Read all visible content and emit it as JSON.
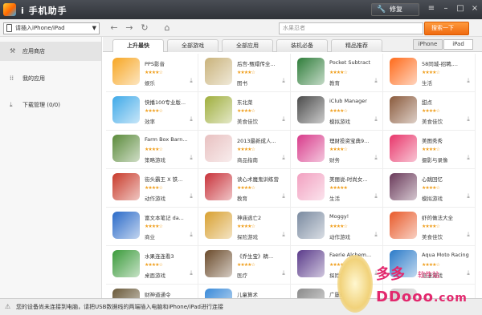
{
  "window": {
    "title": "i 手机助手",
    "repair_label": "修复",
    "repair_icon": "wrench-icon"
  },
  "toolbar": {
    "device_label": "请插入iPhone/iPad",
    "search_placeholder": "水果忍者",
    "search_button": "搜索一下"
  },
  "sidebar": {
    "items": [
      {
        "label": "应用商店",
        "icon": "store-icon"
      },
      {
        "label": "我的应用",
        "icon": "apps-grid-icon"
      },
      {
        "label": "下载管理 (0/0)",
        "icon": "download-icon"
      }
    ]
  },
  "tabs": [
    "上升最快",
    "全部游戏",
    "全部应用",
    "装机必备",
    "精品推荐"
  ],
  "device_toggle": [
    "iPhone",
    "iPad"
  ],
  "apps": [
    {
      "name": "PPS影音",
      "cat": "娱乐",
      "stars": 4,
      "color": "#f7a623"
    },
    {
      "name": "后宫-甄嬛传全...",
      "cat": "图书",
      "stars": 4,
      "color": "#c9b27a"
    },
    {
      "name": "Pocket Subtract",
      "cat": "教育",
      "stars": 4,
      "color": "#2f7d3a"
    },
    {
      "name": "58同城-招聘,...",
      "cat": "生活",
      "stars": 4,
      "color": "#ff6a1a"
    },
    {
      "name": "快播100专业版...",
      "cat": "效率",
      "stars": 4,
      "color": "#3fa9e8"
    },
    {
      "name": "东北菜",
      "cat": "美食佳饮",
      "stars": 4,
      "color": "#9fae3c"
    },
    {
      "name": "iClub Manager",
      "cat": "模拟游戏",
      "stars": 4,
      "color": "#4b4b4b"
    },
    {
      "name": "甜点",
      "cat": "美食佳饮",
      "stars": 4,
      "color": "#8a5a3c"
    },
    {
      "name": "Farm Box Barn...",
      "cat": "策略游戏",
      "stars": 4,
      "color": "#5a8a3a"
    },
    {
      "name": "2013最新成人...",
      "cat": "商品指南",
      "stars": 4,
      "color": "#e8c0c0"
    },
    {
      "name": "理财投资宝典9...",
      "cat": "财务",
      "stars": 4,
      "color": "#d83a8a"
    },
    {
      "name": "美图秀秀",
      "cat": "摄影与录像",
      "stars": 4,
      "color": "#e8356a"
    },
    {
      "name": "街头霸王 X 铁...",
      "cat": "动作游戏",
      "stars": 4,
      "color": "#c83a2a"
    },
    {
      "name": "读心术魔鬼训练营",
      "cat": "教育",
      "stars": 4,
      "color": "#c8323a"
    },
    {
      "name": "美丽说-时尚女...",
      "cat": "生活",
      "stars": 5,
      "color": "#f2a0c0"
    },
    {
      "name": "心跳回忆",
      "cat": "模拟游戏",
      "stars": 4,
      "color": "#6a3a5a"
    },
    {
      "name": "富文本笔记 da...",
      "cat": "商业",
      "stars": 4,
      "color": "#2a6ac8"
    },
    {
      "name": "神庙逃亡2",
      "cat": "探险游戏",
      "stars": 4,
      "color": "#d8a030"
    },
    {
      "name": "Moggy!",
      "cat": "动作游戏",
      "stars": 4,
      "color": "#7a8aa0"
    },
    {
      "name": "虾的做法大全",
      "cat": "美食佳饮",
      "stars": 4,
      "color": "#e85a2a"
    },
    {
      "name": "水果连连看3",
      "cat": "桌面游戏",
      "stars": 4,
      "color": "#3a9a3a"
    },
    {
      "name": "《乔生宝》精...",
      "cat": "医疗",
      "stars": 4,
      "color": "#6a4a2a"
    },
    {
      "name": "Faerie Alchem...",
      "cat": "探险游戏",
      "stars": 4,
      "color": "#5a3a8a"
    },
    {
      "name": "Aqua Moto Racing",
      "cat": "竞速游戏",
      "stars": 4,
      "color": "#2a7ac8"
    },
    {
      "name": "财神道通令",
      "cat": "",
      "stars": 0,
      "color": "#6a5a3a"
    },
    {
      "name": "儿童算术",
      "cat": "",
      "stars": 0,
      "color": "#3a8ad8"
    },
    {
      "name": "广厦球 — ...",
      "cat": "",
      "stars": 0,
      "color": "#8a8a8a"
    },
    {
      "name": "",
      "cat": "",
      "stars": 0,
      "color": "#cccccc"
    }
  ],
  "status": {
    "message": "您的设备尚未连接到电脑，请把USB数据线的两端插入电脑和iPhone/iPad进行连接"
  },
  "watermark": {
    "title": "多多",
    "subtitle": "软件站",
    "domain": "DDooo",
    "tld": ".com"
  }
}
